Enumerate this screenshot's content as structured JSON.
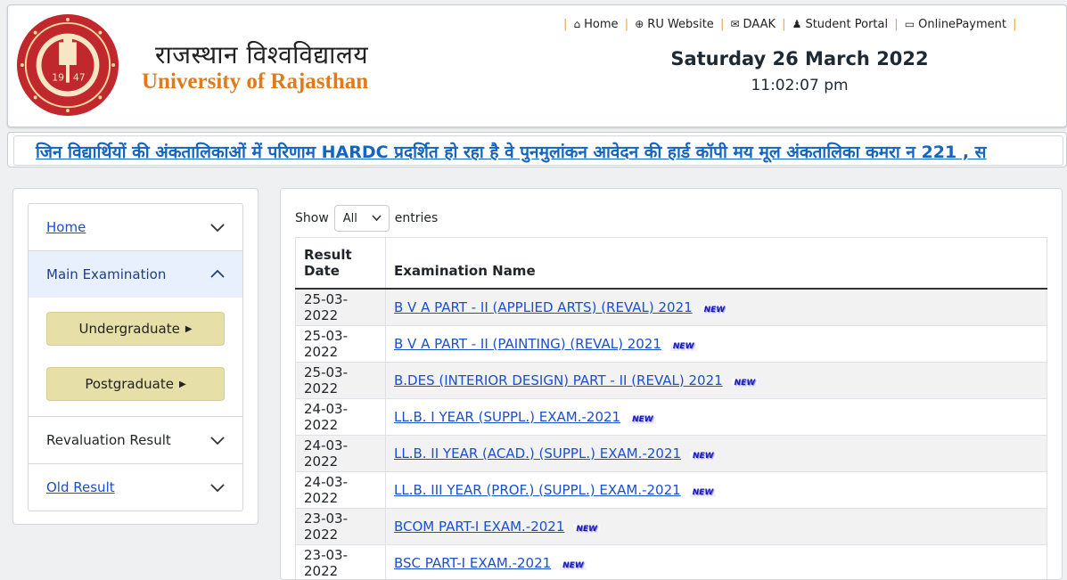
{
  "header": {
    "title_hindi": "राजस्थान विश्वविद्यालय",
    "title_english": "University of Rajasthan",
    "seal_year_left": "19",
    "seal_year_right": "47",
    "date": "Saturday 26 March 2022",
    "time": "11:02:07 pm",
    "nav": [
      {
        "label": "Home",
        "icon": "home-icon"
      },
      {
        "label": "RU Website",
        "icon": "globe-icon"
      },
      {
        "label": "DAAK",
        "icon": "envelope-icon"
      },
      {
        "label": "Student Portal",
        "icon": "user-icon"
      },
      {
        "label": "OnlinePayment",
        "icon": "card-icon"
      }
    ]
  },
  "marquee": {
    "text": "जिन विद्यार्थियों की अंकतालिकाओं में परिणाम HARDC प्रदर्शित हो रहा है वे पुनमुलांकन आवेदन की हार्ड कॉपी मय मूल अंकतालिका कमरा न 221 , स"
  },
  "sidebar": {
    "items": [
      {
        "label": "Home"
      },
      {
        "label": "Main Examination"
      },
      {
        "label": "Revaluation Result"
      },
      {
        "label": "Old Result"
      }
    ],
    "sub_buttons": [
      {
        "label": "Undergraduate"
      },
      {
        "label": "Postgraduate"
      }
    ]
  },
  "table_controls": {
    "show_label": "Show",
    "entries_value": "All",
    "entries_label": "entries"
  },
  "table": {
    "headers": [
      "Result Date",
      "Examination Name"
    ],
    "new_label": "NEW",
    "rows": [
      {
        "date": "25-03-2022",
        "name": "B V A PART - II (APPLIED ARTS) (REVAL) 2021"
      },
      {
        "date": "25-03-2022",
        "name": "B V A PART - II (PAINTING) (REVAL) 2021"
      },
      {
        "date": "25-03-2022",
        "name": "B.DES (INTERIOR DESIGN) PART - II (REVAL) 2021"
      },
      {
        "date": "24-03-2022",
        "name": "LL.B. I YEAR (SUPPL.) EXAM.-2021"
      },
      {
        "date": "24-03-2022",
        "name": "LL.B. II YEAR (ACAD.) (SUPPL.) EXAM.-2021"
      },
      {
        "date": "24-03-2022",
        "name": "LL.B. III YEAR (PROF.) (SUPPL.) EXAM.-2021"
      },
      {
        "date": "23-03-2022",
        "name": "BCOM PART-I EXAM.-2021"
      },
      {
        "date": "23-03-2022",
        "name": "BSC PART-I EXAM.-2021"
      }
    ]
  },
  "colors": {
    "accent_orange": "#e07b1c",
    "link_blue": "#1a4fd0",
    "seal_red": "#c0282d",
    "button_khaki": "#e6e0a8"
  }
}
